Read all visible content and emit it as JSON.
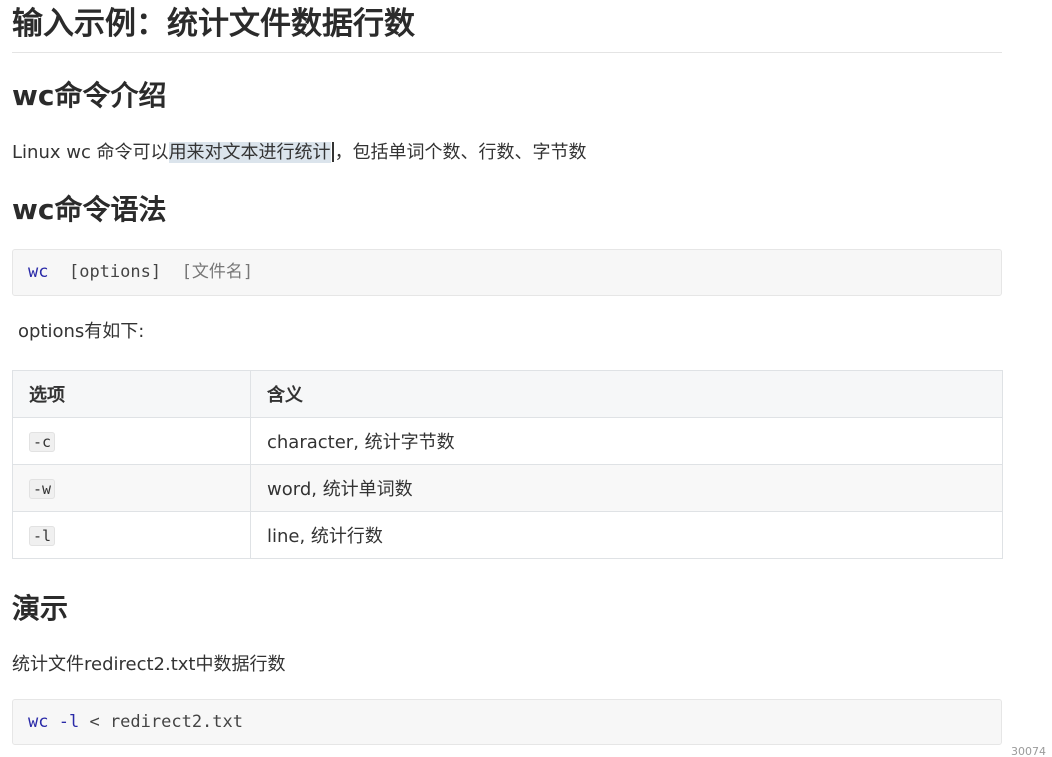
{
  "doc": {
    "title": "输入示例：统计文件数据行数",
    "section_intro": {
      "heading": "wc命令介绍",
      "text_before": "Linux wc 命令可以",
      "text_highlight": "用来对文本进行统计",
      "text_after": "，包括单词个数、行数、字节数"
    },
    "section_syntax": {
      "heading": "wc命令语法",
      "code_cmd": "wc",
      "code_options": "[options]",
      "code_file": "[文件名]",
      "options_intro": "options有如下:"
    },
    "options_table": {
      "headers": [
        "选项",
        "含义"
      ],
      "rows": [
        {
          "option": "-c",
          "meaning": "character, 统计字节数"
        },
        {
          "option": "-w",
          "meaning": "word, 统计单词数"
        },
        {
          "option": "-l",
          "meaning": "line, 统计行数"
        }
      ]
    },
    "section_demo": {
      "heading": "演示",
      "text": "统计文件redirect2.txt中数据行数",
      "code_cmd": "wc",
      "code_flag": "-l",
      "code_rest": "< redirect2.txt"
    },
    "watermark": "30074"
  }
}
